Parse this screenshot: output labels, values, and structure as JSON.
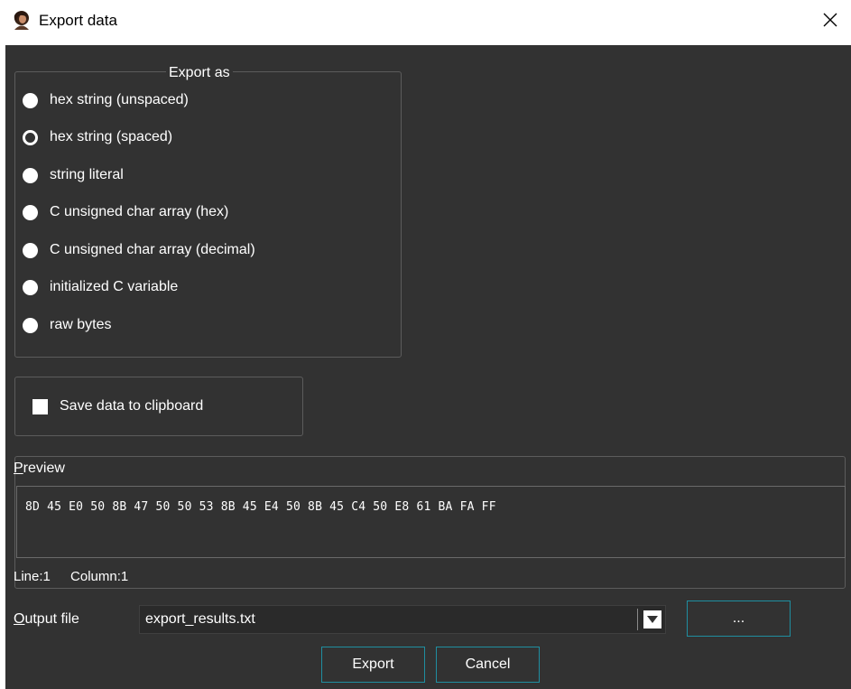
{
  "window": {
    "title": "Export data",
    "close_glyph": "✕"
  },
  "export_as": {
    "title": "Export as",
    "options": [
      {
        "label": "hex string (unspaced)",
        "checked": false
      },
      {
        "label": "hex string (spaced)",
        "checked": true
      },
      {
        "label": "string literal",
        "checked": false
      },
      {
        "label": "C unsigned char array (hex)",
        "checked": false
      },
      {
        "label": "C unsigned char array (decimal)",
        "checked": false
      },
      {
        "label": "initialized C variable",
        "checked": false
      },
      {
        "label": "raw bytes",
        "checked": false
      }
    ]
  },
  "clipboard": {
    "label": "Save data to clipboard",
    "checked": false
  },
  "preview": {
    "title_first": "P",
    "title_rest": "review",
    "content": "8D 45 E0 50 8B 47 50 50 53 8B 45 E4 50 8B 45 C4 50 E8 61 BA FA FF",
    "line_label": "Line:",
    "line_value": "1",
    "column_label": "Column:",
    "column_value": "1"
  },
  "output": {
    "label_first": "O",
    "label_rest": "utput file",
    "value": "export_results.txt",
    "browse_label": "..."
  },
  "buttons": {
    "export": "Export",
    "cancel": "Cancel"
  },
  "icons": {
    "app": "app-portrait-icon",
    "close": "close-icon",
    "dropdown": "dropdown-arrow-icon"
  },
  "colors": {
    "background": "#323232",
    "accent_border": "#1f8ea0",
    "group_border": "#5c5c5c"
  }
}
